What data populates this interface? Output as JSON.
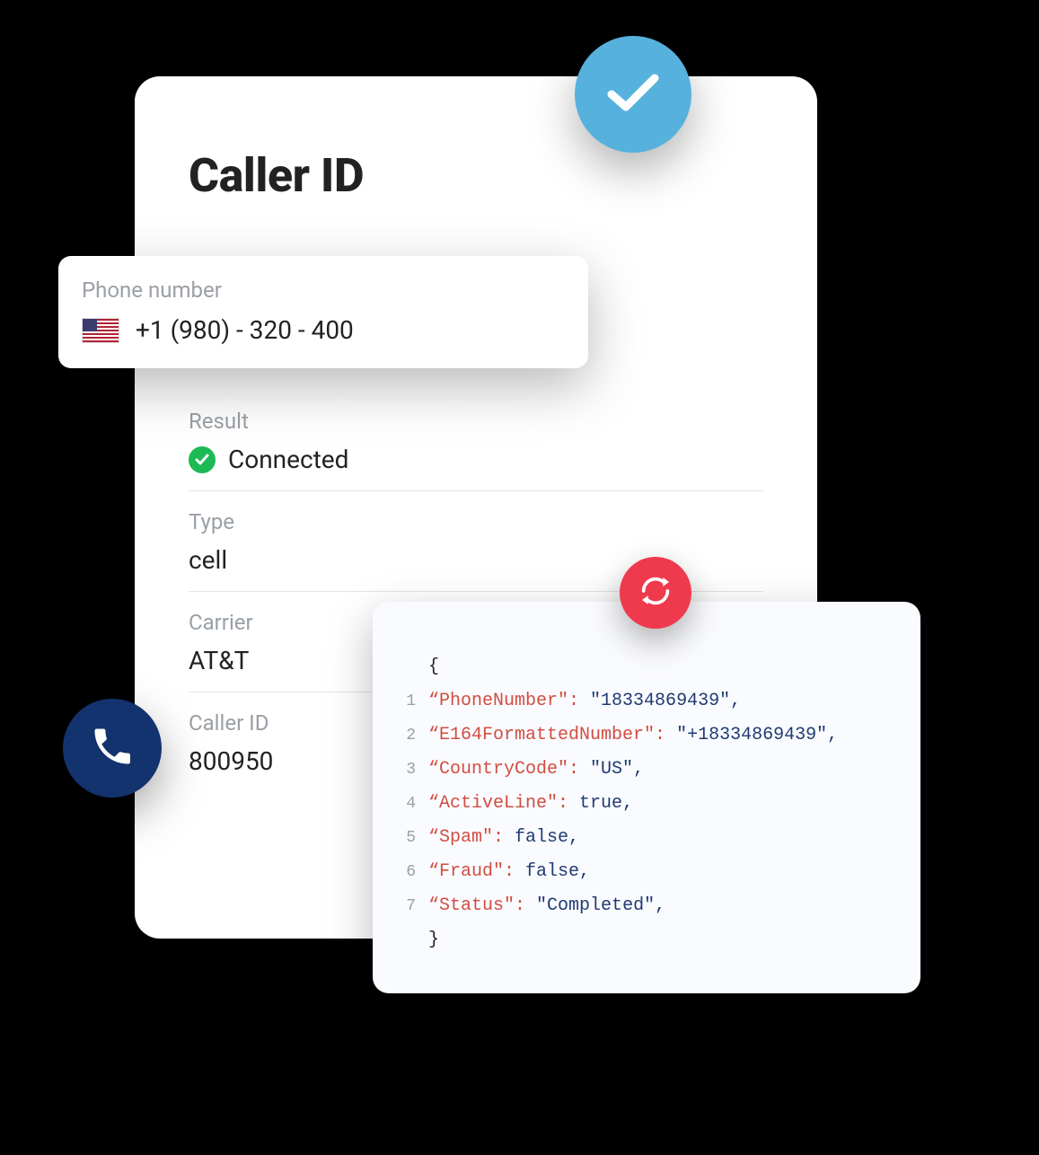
{
  "header": {
    "title": "Caller ID"
  },
  "phone": {
    "label": "Phone number",
    "value": "+1 (980) - 320 - 400",
    "flag": "us-flag"
  },
  "result": {
    "label": "Result",
    "value": "Connected"
  },
  "type": {
    "label": "Type",
    "value": "cell"
  },
  "carrier": {
    "label": "Carrier",
    "value": "AT&T"
  },
  "callerid": {
    "label": "Caller ID",
    "value": "800950"
  },
  "code": {
    "open": "{",
    "close": "}",
    "lines": [
      {
        "n": "1",
        "key": "“PhoneNumber\":",
        "val": "\"18334869439\"",
        "type": "str"
      },
      {
        "n": "2",
        "key": "“E164FormattedNumber\":",
        "val": "\"+18334869439\"",
        "type": "str"
      },
      {
        "n": "3",
        "key": "“CountryCode\":",
        "val": "\"US\"",
        "type": "str"
      },
      {
        "n": "4",
        "key": "“ActiveLine\":",
        "val": "true",
        "type": "bool"
      },
      {
        "n": "5",
        "key": "“Spam\":",
        "val": "false",
        "type": "bool"
      },
      {
        "n": "6",
        "key": "“Fraud\":",
        "val": "false",
        "type": "bool"
      },
      {
        "n": "7",
        "key": "“Status\":",
        "val": "\"Completed\"",
        "type": "str"
      }
    ]
  },
  "colors": {
    "check_badge": "#57b1dd",
    "phone_badge": "#12336e",
    "refresh_badge": "#ef3a4d",
    "result_ok": "#1db954"
  }
}
